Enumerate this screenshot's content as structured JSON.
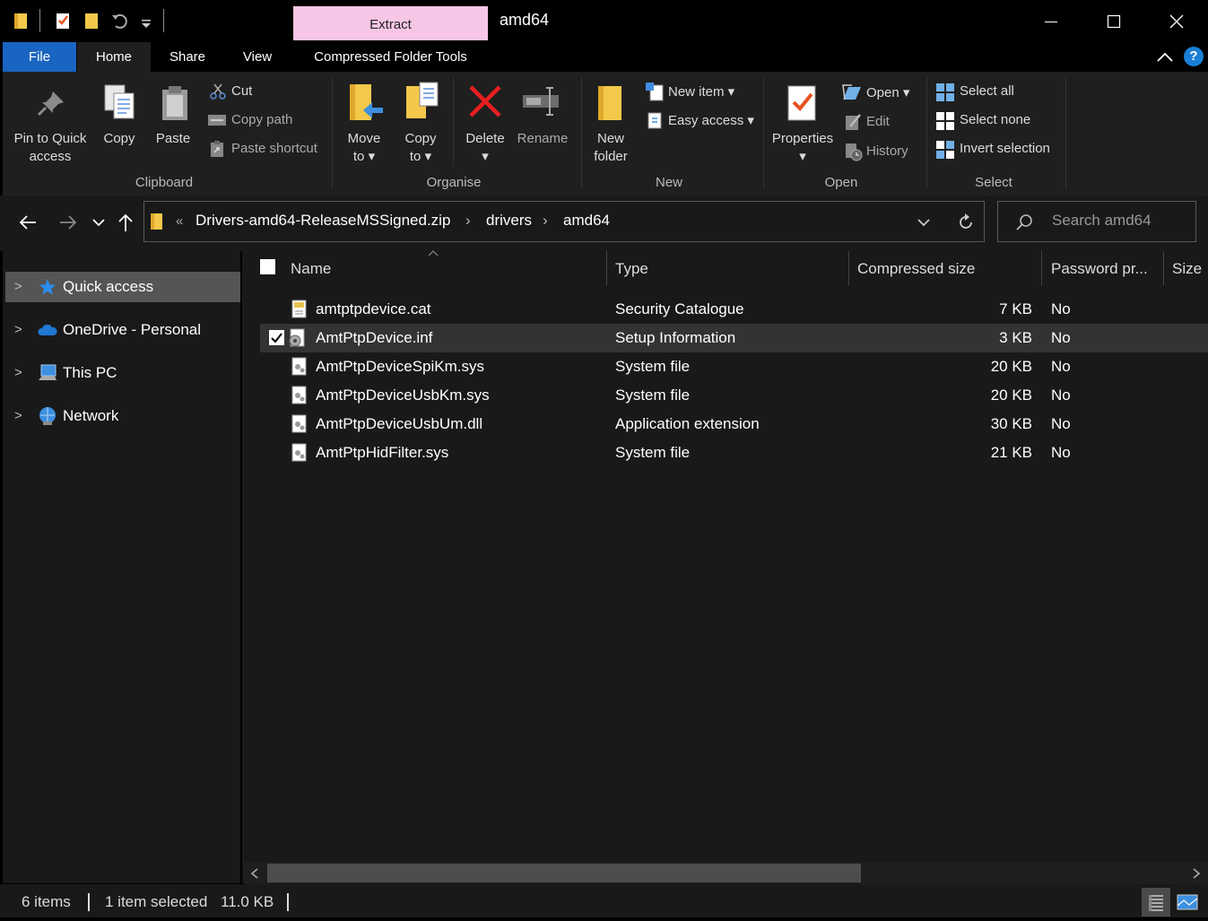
{
  "titlebar": {
    "contextual_tab": "Extract",
    "window_title": "amd64"
  },
  "tabs": {
    "file": "File",
    "home": "Home",
    "share": "Share",
    "view": "View",
    "compressed": "Compressed Folder Tools"
  },
  "ribbon": {
    "clipboard": {
      "pin_line1": "Pin to Quick",
      "pin_line2": "access",
      "copy": "Copy",
      "paste": "Paste",
      "cut": "Cut",
      "copy_path": "Copy path",
      "paste_shortcut": "Paste shortcut",
      "group": "Clipboard"
    },
    "organise": {
      "move_line1": "Move",
      "move_line2": "to",
      "copy_line1": "Copy",
      "copy_line2": "to",
      "delete": "Delete",
      "rename": "Rename",
      "group": "Organise"
    },
    "new": {
      "folder_line1": "New",
      "folder_line2": "folder",
      "new_item": "New item",
      "easy_access": "Easy access",
      "group": "New"
    },
    "open": {
      "properties": "Properties",
      "open": "Open",
      "edit": "Edit",
      "history": "History",
      "group": "Open"
    },
    "select": {
      "select_all": "Select all",
      "select_none": "Select none",
      "invert": "Invert selection",
      "group": "Select"
    }
  },
  "address": {
    "overflow": "«",
    "crumbs": [
      "Drivers-amd64-ReleaseMSSigned.zip",
      "drivers",
      "amd64"
    ],
    "search_placeholder": "Search amd64"
  },
  "nav": {
    "items": [
      {
        "label": "Quick access",
        "icon": "star-icon"
      },
      {
        "label": "OneDrive - Personal",
        "icon": "cloud-icon"
      },
      {
        "label": "This PC",
        "icon": "computer-icon"
      },
      {
        "label": "Network",
        "icon": "network-icon"
      }
    ]
  },
  "columns": {
    "name": "Name",
    "type": "Type",
    "compressed": "Compressed size",
    "password": "Password pr...",
    "size": "Size"
  },
  "files": [
    {
      "name": "amtptpdevice.cat",
      "type": "Security Catalogue",
      "compressed": "7 KB",
      "password": "No"
    },
    {
      "name": "AmtPtpDevice.inf",
      "type": "Setup Information",
      "compressed": "3 KB",
      "password": "No"
    },
    {
      "name": "AmtPtpDeviceSpiKm.sys",
      "type": "System file",
      "compressed": "20 KB",
      "password": "No"
    },
    {
      "name": "AmtPtpDeviceUsbKm.sys",
      "type": "System file",
      "compressed": "20 KB",
      "password": "No"
    },
    {
      "name": "AmtPtpDeviceUsbUm.dll",
      "type": "Application extension",
      "compressed": "30 KB",
      "password": "No"
    },
    {
      "name": "AmtPtpHidFilter.sys",
      "type": "System file",
      "compressed": "21 KB",
      "password": "No"
    }
  ],
  "status": {
    "count": "6 items",
    "selected": "1 item selected",
    "size": "11.0 KB"
  },
  "colors": {
    "file_tab": "#1a64c2",
    "extract_tab": "#f7c6e6",
    "selection": "#333333"
  }
}
